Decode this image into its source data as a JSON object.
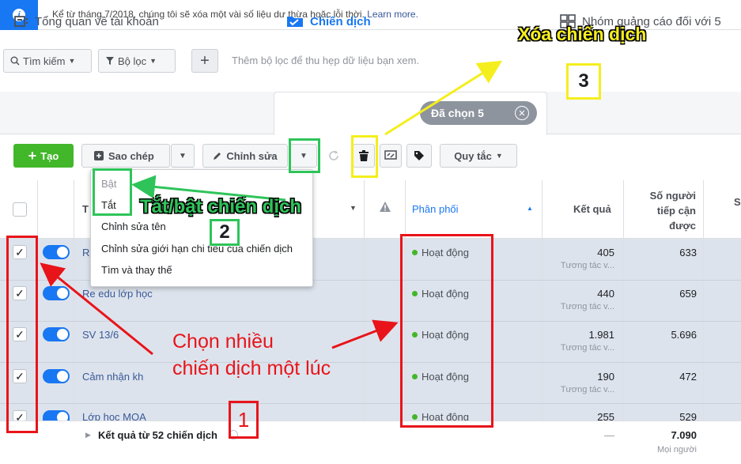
{
  "notice": {
    "icon": "info-icon",
    "text": "Kể từ tháng 7/2018, chúng tôi sẽ xóa một vài số liệu dư thừa hoặc lỗi thời.",
    "link": "Learn more."
  },
  "filters": {
    "search": "Tìm kiếm",
    "filter": "Bộ lọc",
    "add_icon": "+",
    "hint": "Thêm bộ lọc để thu hẹp dữ liệu bạn xem."
  },
  "tabs": {
    "overview": "Tổng quan về tài khoản",
    "campaigns": "Chiến dịch",
    "selected": "Đã chọn 5",
    "adsets": "Nhóm quảng cáo đối với 5"
  },
  "toolbar": {
    "create": "Tạo",
    "copy": "Sao chép",
    "edit": "Chỉnh sửa",
    "rules": "Quy tắc"
  },
  "table": {
    "headers": {
      "name": "T",
      "delivery": "Phân phối",
      "results": "Kết quả",
      "reach": "Số người tiếp cận được",
      "extra": "S"
    },
    "rows": [
      {
        "name": "R",
        "status": "Hoạt động",
        "result": "405",
        "result_sub": "Tương tác v...",
        "reach": "633"
      },
      {
        "name": "Re edu lớp học",
        "status": "Hoạt động",
        "result": "440",
        "result_sub": "Tương tác v...",
        "reach": "659"
      },
      {
        "name": "SV 13/6",
        "status": "Hoạt động",
        "result": "1.981",
        "result_sub": "Tương tác v...",
        "reach": "5.696"
      },
      {
        "name": "Cảm nhận kh",
        "status": "Hoạt động",
        "result": "190",
        "result_sub": "Tương tác v...",
        "reach": "472"
      },
      {
        "name": "Lớp học MOA",
        "status": "Hoạt động",
        "result": "255",
        "result_sub": "",
        "reach": "529"
      }
    ],
    "footer": {
      "label": "Kết quả từ 52 chiến dịch",
      "result": "—",
      "reach": "7.090",
      "reach_sub": "Mọi người"
    }
  },
  "menu": {
    "items": [
      "Bật",
      "Tắt",
      "Chỉnh sửa tên",
      "Chỉnh sửa giới hạn chi tiêu của chiến dịch",
      "Tìm và thay thế"
    ]
  },
  "annotations": {
    "delete_label": "Xóa chiến dịch",
    "num3": "3",
    "toggle_label": "Tắt/bật chiến dịch",
    "num2": "2",
    "multi_line1": "Chọn nhiều",
    "multi_line2": "chiến dịch một lúc",
    "num1": "1"
  },
  "colors": {
    "accent": "#1877f2",
    "annotation_red": "#e8141a",
    "annotation_green": "#2ec45a",
    "annotation_yellow": "#f5ee1d"
  }
}
